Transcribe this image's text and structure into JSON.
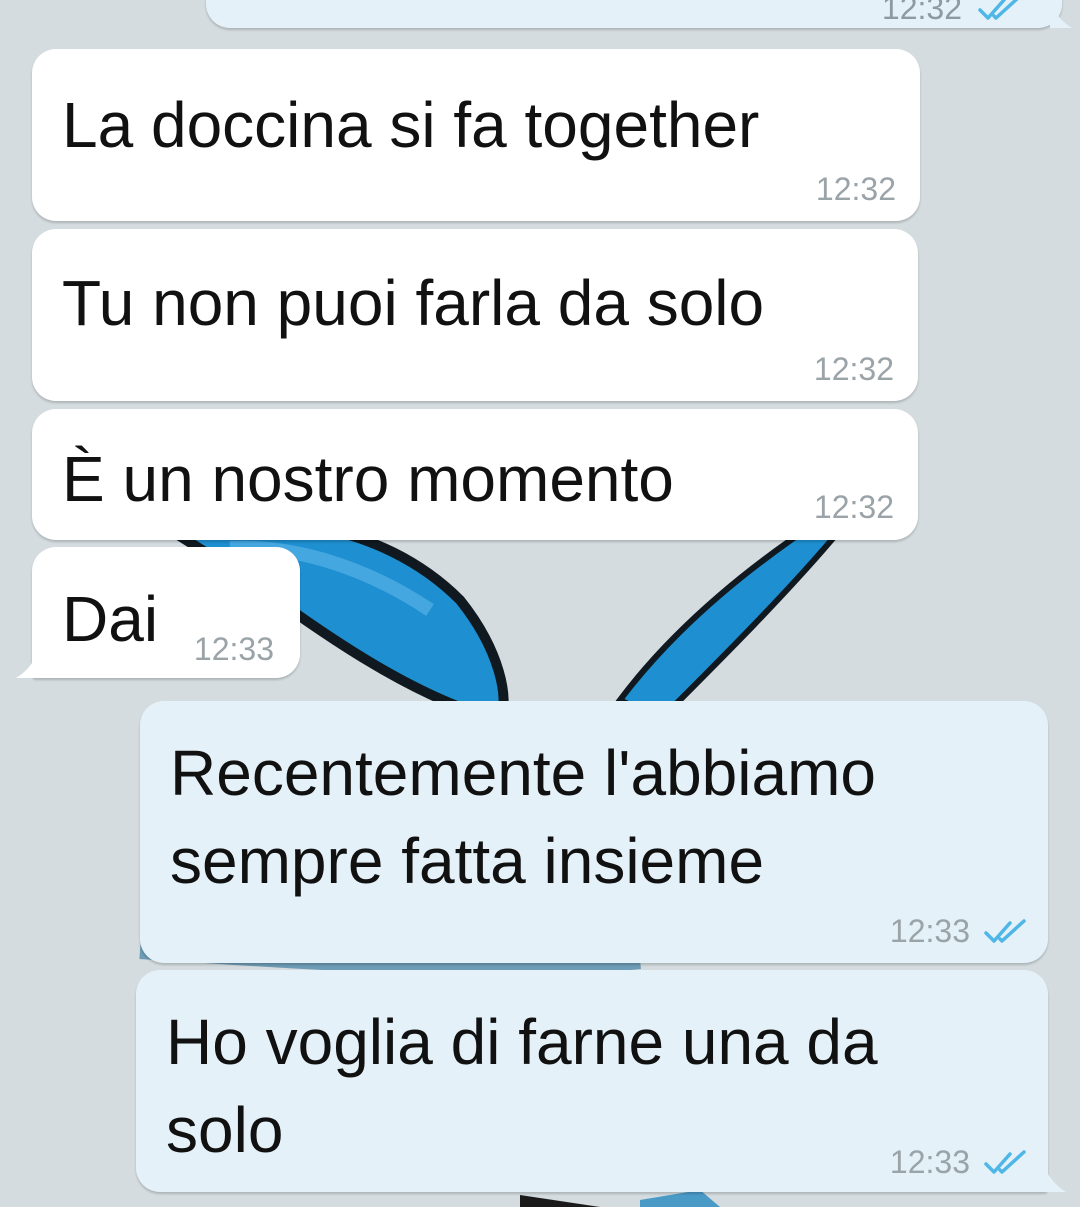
{
  "colors": {
    "wallpaper": "#d4dcdf",
    "incoming_bubble": "#ffffff",
    "outgoing_bubble": "#e4f1f8",
    "message_text": "#111111",
    "timestamp": "#9aa3a8",
    "read_ticks": "#4fb6e8",
    "butterfly_wing": "#1e8fd0"
  },
  "icons": {
    "read_receipt": "double-check-icon",
    "wallpaper": "butterfly-wallpaper"
  },
  "messages": [
    {
      "direction": "outgoing",
      "text": "",
      "time": "12:32",
      "ticks": true
    },
    {
      "direction": "incoming",
      "text": "La doccina si fa together",
      "time": "12:32"
    },
    {
      "direction": "incoming",
      "text": "Tu non puoi farla da solo",
      "time": "12:32"
    },
    {
      "direction": "incoming",
      "text": "È un nostro momento",
      "time": "12:32"
    },
    {
      "direction": "incoming",
      "text": "Dai",
      "time": "12:33"
    },
    {
      "direction": "outgoing",
      "text_line1": "Recentemente l'abbiamo",
      "text_line2": "sempre fatta insieme",
      "time": "12:33",
      "ticks": true
    },
    {
      "direction": "outgoing",
      "text_line1": "Ho voglia di farne una da",
      "text_line2": "solo",
      "time": "12:33",
      "ticks": true
    }
  ]
}
